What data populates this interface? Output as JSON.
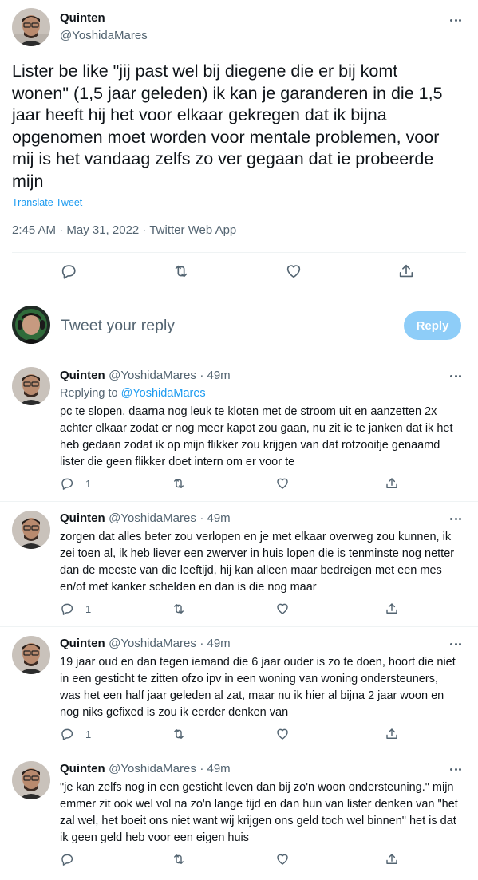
{
  "main_tweet": {
    "author_name": "Quinten",
    "author_handle": "@YoshidaMares",
    "text": "Lister be like \"jij past wel bij diegene die er bij komt wonen\" (1,5 jaar geleden) ik kan je garanderen in die 1,5 jaar heeft hij het voor elkaar gekregen dat ik bijna opgenomen moet worden voor mentale problemen, voor mij is het vandaag zelfs zo ver gegaan dat ie probeerde mijn",
    "translate_label": "Translate Tweet",
    "meta": "2:45 AM · May 31, 2022 · Twitter Web App"
  },
  "composer": {
    "placeholder": "Tweet your reply",
    "reply_button": "Reply"
  },
  "replies": [
    {
      "name": "Quinten",
      "handle": "@YoshidaMares",
      "time": "· 49m",
      "replying_prefix": "Replying to ",
      "replying_handle": "@YoshidaMares",
      "text": "pc te slopen, daarna nog leuk te kloten met de stroom uit en aanzetten 2x achter elkaar zodat er nog meer kapot zou gaan, nu zit ie te janken dat ik het heb gedaan zodat ik op mijn flikker zou krijgen van dat rotzooitje genaamd lister die geen flikker doet intern om er voor te",
      "reply_count": "1"
    },
    {
      "name": "Quinten",
      "handle": "@YoshidaMares",
      "time": "· 49m",
      "text": "zorgen dat alles beter zou verlopen en je met elkaar overweg zou kunnen, ik zei toen al, ik heb liever een zwerver in huis lopen die is tenminste nog netter dan de meeste van die leeftijd, hij kan alleen maar bedreigen met een mes en/of met kanker schelden en dan is die nog maar",
      "reply_count": "1"
    },
    {
      "name": "Quinten",
      "handle": "@YoshidaMares",
      "time": "· 49m",
      "text": "19 jaar oud en dan tegen iemand die 6 jaar ouder is zo te doen, hoort die niet in een gesticht te zitten ofzo ipv in een woning van woning ondersteuners, was het een half jaar geleden al zat, maar nu ik hier al bijna 2 jaar woon en nog niks gefixed is zou ik eerder denken van",
      "reply_count": "1"
    },
    {
      "name": "Quinten",
      "handle": "@YoshidaMares",
      "time": "· 49m",
      "text": "\"je kan zelfs nog in een gesticht leven dan bij zo'n woon ondersteuning.\" mijn emmer zit ook wel vol na zo'n lange tijd en dan hun van lister denken van \"het zal wel, het boeit ons niet want wij krijgen ons geld toch wel binnen\" het is dat ik geen geld heb voor een eigen huis",
      "reply_count": ""
    }
  ],
  "colors": {
    "accent": "#1d9bf0",
    "reply_button_disabled": "#8ecdf8",
    "text_primary": "#0f1419",
    "text_secondary": "#536471",
    "divider": "#eff3f4"
  },
  "icons": {
    "reply": "speech-bubble-icon",
    "retweet": "retweet-icon",
    "like": "heart-icon",
    "share": "share-icon",
    "more": "more-dots-icon"
  }
}
